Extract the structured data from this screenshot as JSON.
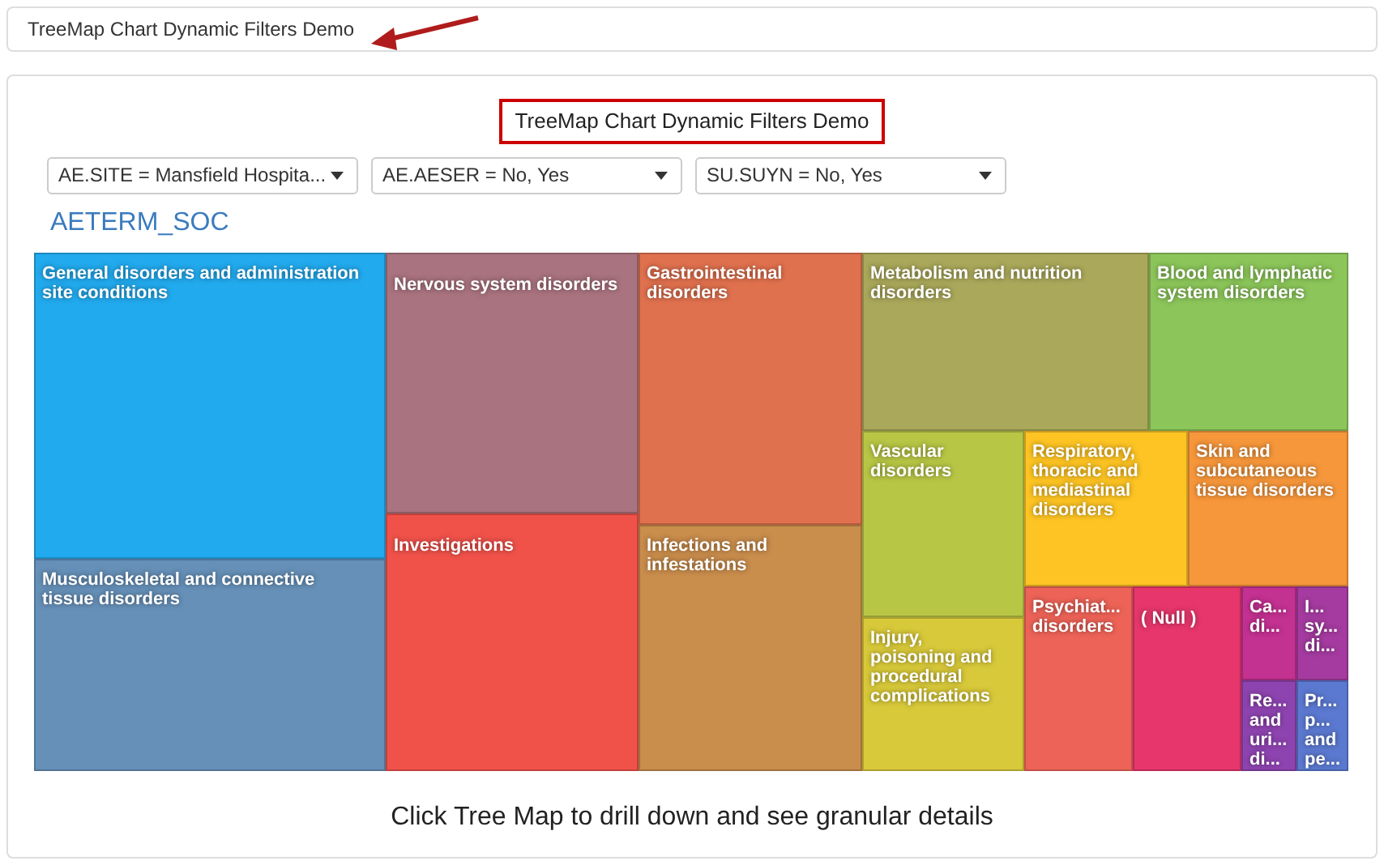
{
  "header": {
    "title": "TreeMap Chart Dynamic Filters Demo"
  },
  "panel": {
    "title": "TreeMap Chart Dynamic Filters Demo",
    "filters": [
      {
        "value": "AE.SITE = Mansfield Hospita..."
      },
      {
        "value": "AE.AESER = No, Yes"
      },
      {
        "value": "SU.SUYN = No, Yes"
      }
    ],
    "treemap_title": "AETERM_SOC",
    "tiles": [
      {
        "lines": [
          "General disorders and administration",
          "site conditions"
        ],
        "color": "#22aaee"
      },
      {
        "lines": [
          "Musculoskeletal and connective",
          "tissue disorders"
        ],
        "color": "#6690b8"
      },
      {
        "lines": [
          "Nervous system disorders"
        ],
        "color": "#a9737f"
      },
      {
        "lines": [
          "Investigations"
        ],
        "color": "#f0524a"
      },
      {
        "lines": [
          "Gastrointestinal",
          "disorders"
        ],
        "color": "#e0714e"
      },
      {
        "lines": [
          "Infections and",
          "infestations"
        ],
        "color": "#c98d4c"
      },
      {
        "lines": [
          "Metabolism and nutrition",
          "disorders"
        ],
        "color": "#aaa85a"
      },
      {
        "lines": [
          "Blood and lymphatic",
          "system disorders"
        ],
        "color": "#8cc65a"
      },
      {
        "lines": [
          "Vascular",
          "disorders"
        ],
        "color": "#b8c645"
      },
      {
        "lines": [
          "Injury,",
          "poisoning and",
          "procedural",
          "complications"
        ],
        "color": "#d8c93a"
      },
      {
        "lines": [
          "Respiratory,",
          "thoracic and",
          "mediastinal",
          "disorders"
        ],
        "color": "#fdc423"
      },
      {
        "lines": [
          "Skin and",
          "subcutaneous",
          "tissue disorders"
        ],
        "color": "#f7973b"
      },
      {
        "lines": [
          "Psychiat...",
          "disorders"
        ],
        "color": "#ee6358"
      },
      {
        "lines": [
          "( Null )"
        ],
        "color": "#e6366c"
      },
      {
        "lines": [
          "Ca...",
          "di..."
        ],
        "color": "#c33191"
      },
      {
        "lines": [
          "I...",
          "sy...",
          "di..."
        ],
        "color": "#a53ba0"
      },
      {
        "lines": [
          "Re...",
          "and",
          "uri...",
          "di..."
        ],
        "color": "#8e44b0"
      },
      {
        "lines": [
          "Pr...",
          "p...",
          "and",
          "pe..."
        ],
        "color": "#5b79d0"
      }
    ],
    "footer": "Click Tree Map to drill down and see granular details"
  }
}
